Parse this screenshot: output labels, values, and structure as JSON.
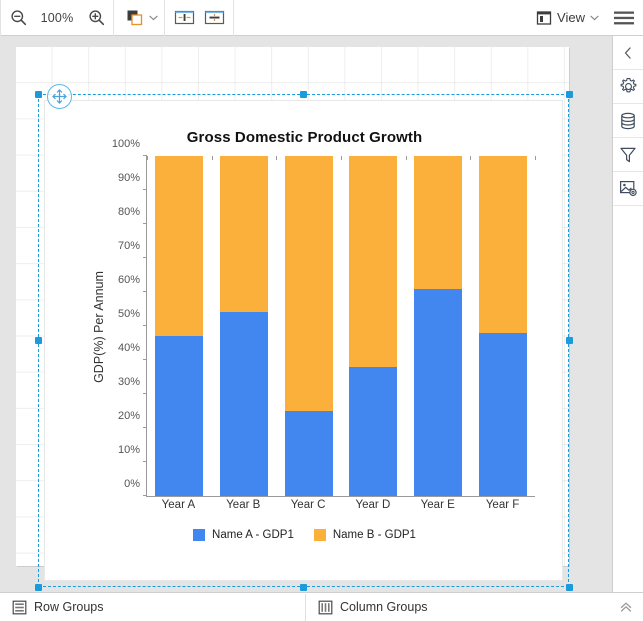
{
  "toolbar": {
    "zoom_out_icon": "zoom-out-icon",
    "zoom_level": "100%",
    "zoom_in_icon": "zoom-in-icon",
    "bring_to_front_icon": "layer-order-icon",
    "bring_to_front_chevron": "chevron-down-icon",
    "fit_width_icon": "align-horizontal-icon",
    "fit_height_icon": "align-vertical-icon",
    "view_icon": "panel-layout-icon",
    "view_label": "View",
    "view_chevron": "chevron-down-icon",
    "menu_icon": "hamburger-menu-icon"
  },
  "rail": {
    "items": [
      {
        "name": "collapse-panel",
        "icon": "chevron-left-icon"
      },
      {
        "name": "properties",
        "icon": "gear-icon"
      },
      {
        "name": "data-sources",
        "icon": "database-icon"
      },
      {
        "name": "filters",
        "icon": "funnel-icon"
      },
      {
        "name": "chart-settings",
        "icon": "image-settings-icon"
      }
    ]
  },
  "canvas": {
    "move_handle_icon": "move-handle-icon",
    "selection_color": "#1b9bdc"
  },
  "chart_data": {
    "type": "bar",
    "stacked": true,
    "title": "Gross Domestic Product Growth",
    "xlabel": "",
    "ylabel": "GDP(%) Per Annum",
    "categories": [
      "Year A",
      "Year B",
      "Year C",
      "Year D",
      "Year E",
      "Year F"
    ],
    "ylim": [
      0,
      100
    ],
    "yticks": [
      "0%",
      "10%",
      "20%",
      "30%",
      "40%",
      "50%",
      "60%",
      "70%",
      "80%",
      "90%",
      "100%"
    ],
    "ytick_values": [
      0,
      10,
      20,
      30,
      40,
      50,
      60,
      70,
      80,
      90,
      100
    ],
    "grid": false,
    "legend_position": "bottom",
    "series": [
      {
        "name": "Name A - GDP1",
        "color": "#4286ef",
        "values": [
          47,
          54,
          25,
          38,
          61,
          48
        ]
      },
      {
        "name": "Name B - GDP1",
        "color": "#fbb03b",
        "values": [
          53,
          46,
          75,
          62,
          39,
          52
        ]
      }
    ]
  },
  "groups_bar": {
    "row_groups_icon": "rows-icon",
    "row_groups_label": "Row Groups",
    "column_groups_icon": "columns-icon",
    "column_groups_label": "Column Groups",
    "collapse_icon": "double-chevron-up-icon"
  }
}
